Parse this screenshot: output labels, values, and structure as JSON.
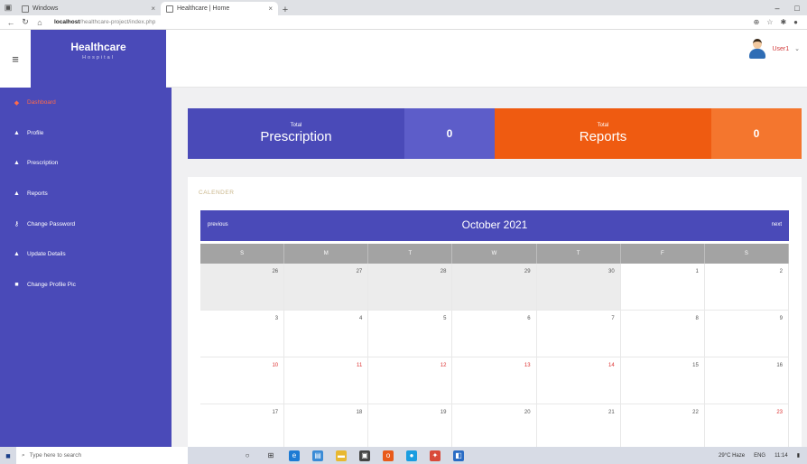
{
  "browser": {
    "tabs": [
      {
        "label": "Windows"
      },
      {
        "label": "Healthcare | Home"
      }
    ],
    "url_host": "localhost",
    "url_path": "/healthcare-project/index.php"
  },
  "brand": {
    "title": "Healthcare",
    "subtitle": "Hospital"
  },
  "user": {
    "name": "User1"
  },
  "sidebar": {
    "items": [
      {
        "label": "Dashboard",
        "icon": "home-icon"
      },
      {
        "label": "Profile",
        "icon": "user-icon"
      },
      {
        "label": "Prescription",
        "icon": "user-icon"
      },
      {
        "label": "Reports",
        "icon": "user-icon"
      },
      {
        "label": "Change Password",
        "icon": "key-icon"
      },
      {
        "label": "Update Details",
        "icon": "user-icon"
      },
      {
        "label": "Change Profile Pic",
        "icon": "camera-icon"
      }
    ]
  },
  "stats": [
    {
      "small": "Total",
      "label": "Prescription",
      "value": "0"
    },
    {
      "small": "Total",
      "label": "Reports",
      "value": "0"
    }
  ],
  "calendar": {
    "section_title": "CALENDER",
    "prev_label": "previous",
    "month": "October 2021",
    "next_label": "next",
    "weekdays": [
      "S",
      "M",
      "T",
      "W",
      "T",
      "F",
      "S"
    ],
    "weeks": [
      [
        "26",
        "27",
        "28",
        "29",
        "30",
        "1",
        "2"
      ],
      [
        "3",
        "4",
        "5",
        "6",
        "7",
        "8",
        "9"
      ],
      [
        "10",
        "11",
        "12",
        "13",
        "14",
        "15",
        "16"
      ],
      [
        "17",
        "18",
        "19",
        "20",
        "21",
        "22",
        "23"
      ]
    ]
  },
  "taskbar": {
    "search_placeholder": "Type here to search",
    "weather": "29°C Haze",
    "lang": "ENG",
    "time": "11:14"
  },
  "colors": {
    "primary": "#4a4ab8",
    "accent": "#ef5b11"
  }
}
